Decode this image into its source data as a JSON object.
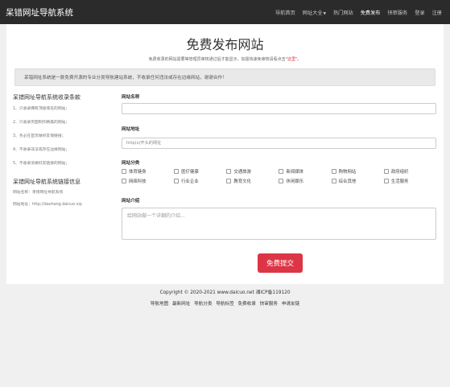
{
  "navbar": {
    "brand": "呆错网址导航系统",
    "items": [
      {
        "label": "导航首页"
      },
      {
        "label": "网址大全"
      },
      {
        "label": "热门网站"
      },
      {
        "label": "免费发布"
      },
      {
        "label": "快审服务"
      },
      {
        "label": "登录"
      },
      {
        "label": "注册"
      }
    ]
  },
  "page": {
    "title": "免费发布网站",
    "subtitle_before": "免费收录的网站需要等管理员审核通过后才能显示，如需快速免审核请看点击",
    "subtitle_link": "\"这里\"",
    "subtitle_after": "。",
    "notice": "呆错网址系统是一款免费开源的专业分类导航建站系统，不收录任何违法或存在边缘网站，谢谢合作！"
  },
  "rules": {
    "title": "呆错网址导航系统收录条款",
    "items": [
      "1、只收录拥有顶级域名的网站；",
      "2、只收录页面制作精美的网站；",
      "3、务必在首页做好友情链接；",
      "4、不收录非法或存在边缘网站；",
      "5、不收录没做好友链接的网站；"
    ],
    "link_title": "呆错网址导航系统链接信息",
    "link_name": "网站名称：呆错网址导航系统",
    "link_url": "网站地址：http://daohang.daicuo.vip"
  },
  "form": {
    "name_label": "网站名称",
    "name_value": "",
    "url_label": "网站地址",
    "url_placeholder": "http(s)开头的网址",
    "category_label": "网站分类",
    "categories": [
      "体育健身",
      "医疗健康",
      "交通旅游",
      "新闻媒体",
      "购物网站",
      "政府组织",
      "网络科技",
      "行业企业",
      "教育文化",
      "休闲娱乐",
      "综合其他",
      "生活服务"
    ],
    "desc_label": "网站介绍",
    "desc_placeholder": "给网站做一个详细的介绍...",
    "submit_label": "免费提交"
  },
  "footer": {
    "copyright": "Copyright © 2020-2021 www.daicuo.net 湘ICP备119120",
    "links": [
      "导航地图",
      "最新网址",
      "导航分类",
      "导航标签",
      "免费收录",
      "快审服务",
      "申请友链"
    ]
  },
  "colors": {
    "navbar_bg": "#2b2b2b",
    "accent": "#dc3545"
  }
}
